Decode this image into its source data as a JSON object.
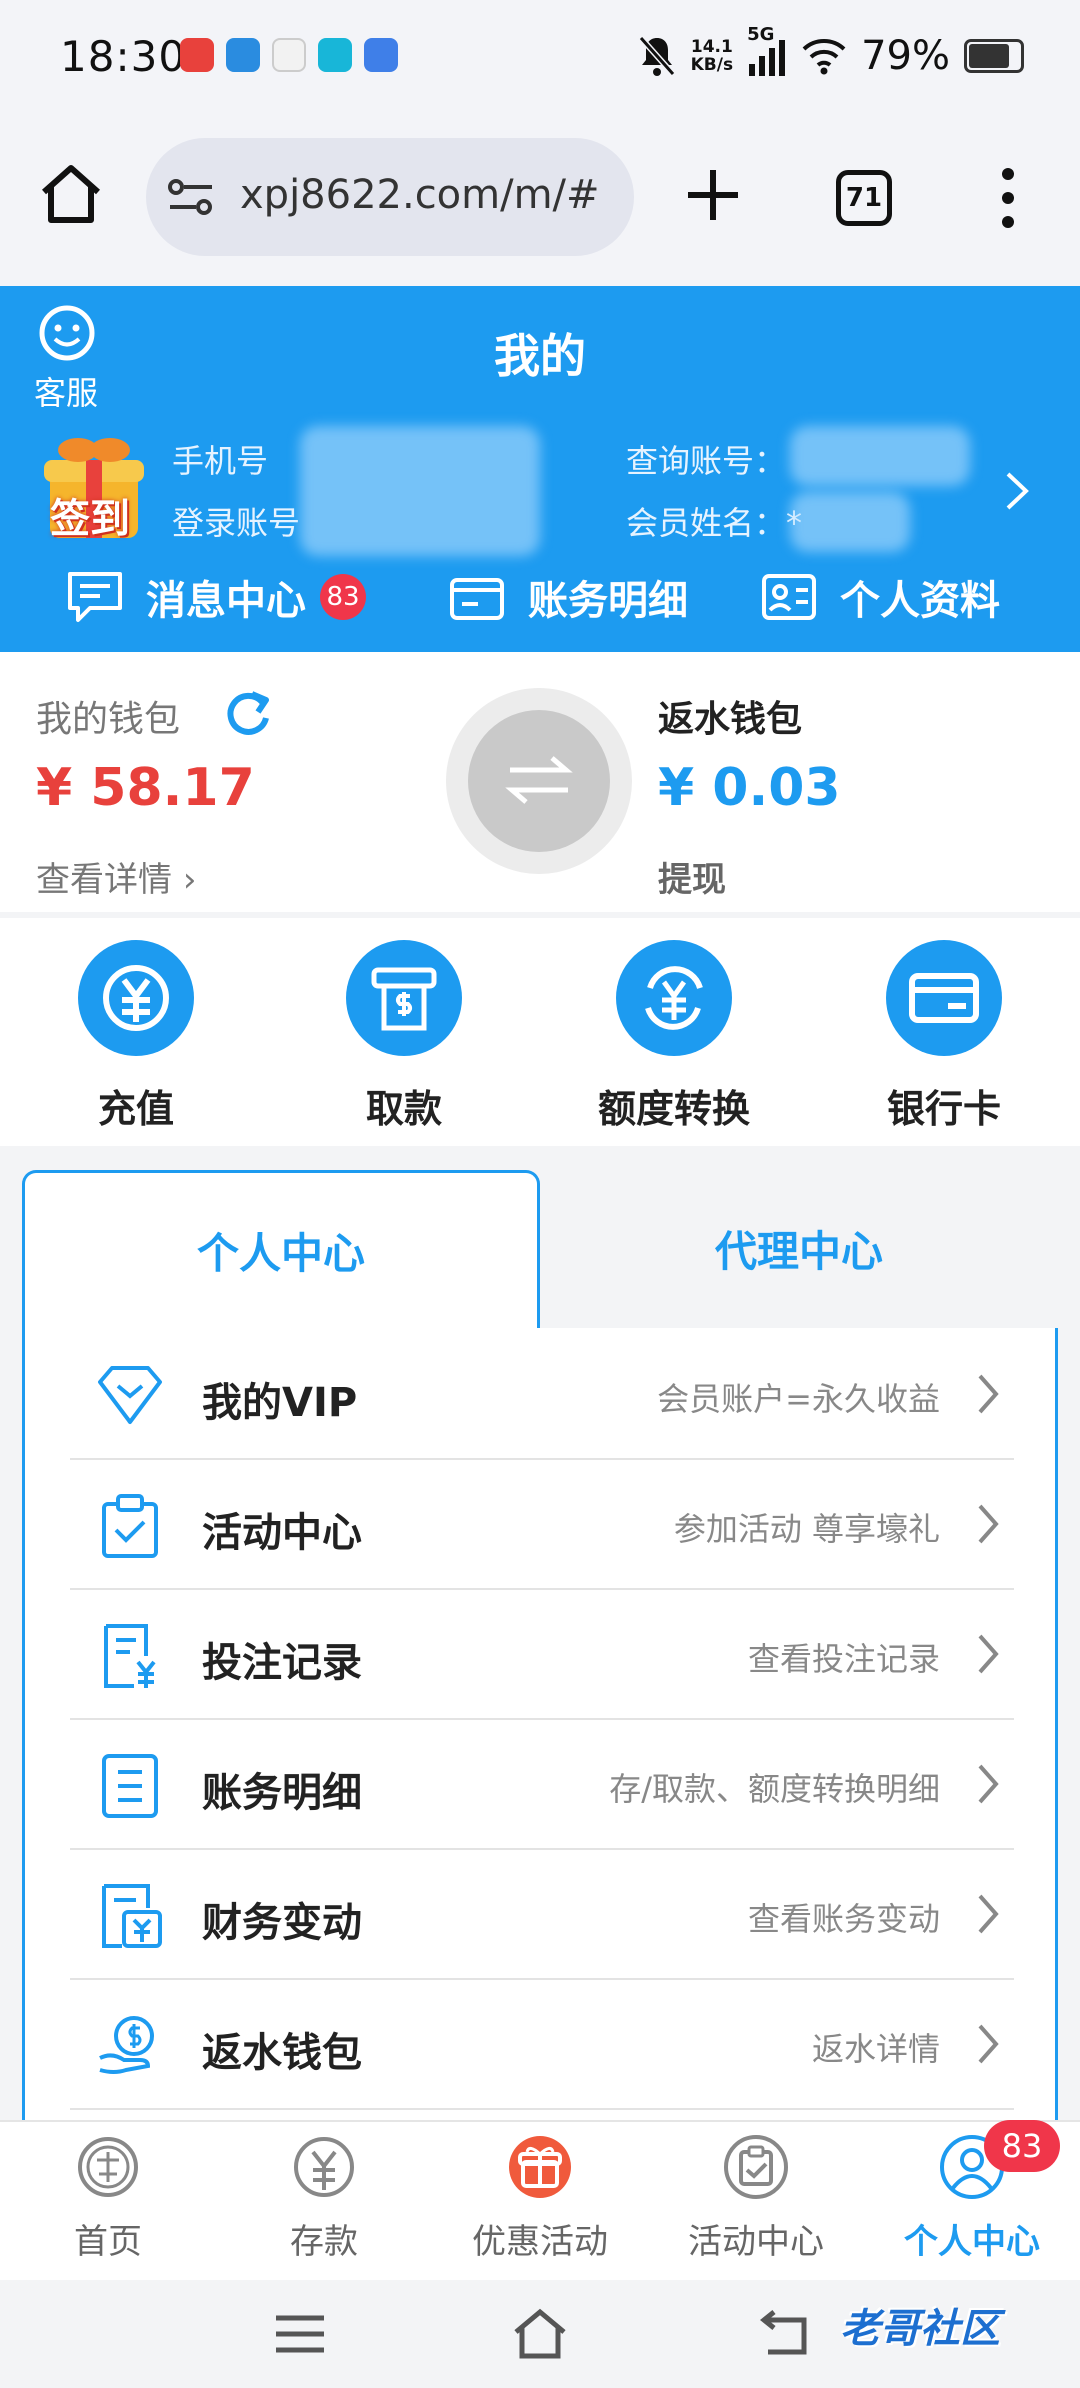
{
  "status_bar": {
    "time": "18:30",
    "net_speed_value": "14.1",
    "net_speed_unit": "KB/s",
    "network": "5G",
    "battery": "79%",
    "battery_level": 0.79
  },
  "browser": {
    "url": "xpj8622.com/m/#",
    "tab_count": "71"
  },
  "header": {
    "title": "我的",
    "customer_service": "客服",
    "checkin_label": "签到",
    "phone_label": "手机号",
    "login_label": "登录账号",
    "query_label": "查询账号：",
    "name_label": "会员姓名：*",
    "quick_links": {
      "messages": "消息中心",
      "messages_badge": "83",
      "bills": "账务明细",
      "profile": "个人资料"
    }
  },
  "wallet": {
    "my_wallet_label": "我的钱包",
    "my_wallet_amount": "¥ 58.17",
    "details_link": "查看详情",
    "rebate_label": "返水钱包",
    "rebate_amount": "¥ 0.03",
    "withdraw_link": "提现"
  },
  "actions": [
    {
      "label": "充值",
      "icon": "yuan-circle-icon"
    },
    {
      "label": "取款",
      "icon": "atm-icon"
    },
    {
      "label": "额度转换",
      "icon": "yuan-refresh-icon"
    },
    {
      "label": "银行卡",
      "icon": "bank-card-icon"
    }
  ],
  "tabs": {
    "personal": "个人中心",
    "agent": "代理中心"
  },
  "menu": [
    {
      "title": "我的VIP",
      "subtitle": "会员账户=永久收益",
      "icon": "diamond-icon"
    },
    {
      "title": "活动中心",
      "subtitle": "参加活动 尊享壕礼",
      "icon": "clipboard-check-icon"
    },
    {
      "title": "投注记录",
      "subtitle": "查看投注记录",
      "icon": "bet-record-icon"
    },
    {
      "title": "账务明细",
      "subtitle": "存/取款、额度转换明细",
      "icon": "ledger-icon"
    },
    {
      "title": "财务变动",
      "subtitle": "查看账务变动",
      "icon": "finance-change-icon"
    },
    {
      "title": "返水钱包",
      "subtitle": "返水详情",
      "icon": "rebate-hand-icon"
    }
  ],
  "bottom_nav": [
    {
      "label": "首页",
      "icon": "lottery-icon"
    },
    {
      "label": "存款",
      "icon": "deposit-icon"
    },
    {
      "label": "优惠活动",
      "icon": "gift-icon"
    },
    {
      "label": "活动中心",
      "icon": "activity-icon"
    },
    {
      "label": "个人中心",
      "icon": "user-icon",
      "badge": "83",
      "active": true
    }
  ],
  "watermark": "老哥社区",
  "colors": {
    "brand_blue": "#1d9bf0",
    "amount_red": "#e8413c",
    "badge_red": "#f0364a"
  }
}
